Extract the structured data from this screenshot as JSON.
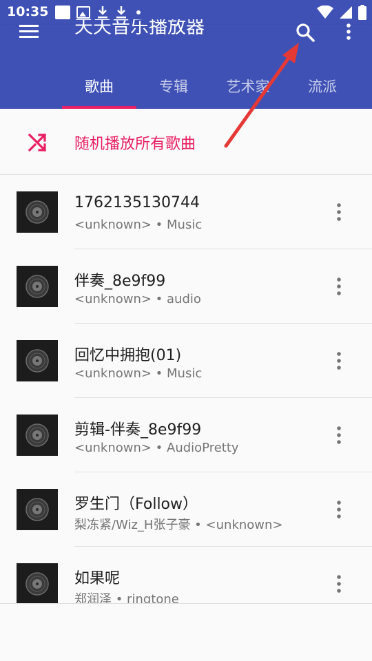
{
  "status_bar": {
    "time": "10:35",
    "icons": [
      "notification-square-icon",
      "image-icon",
      "download-icon",
      "download-icon",
      "dot-icon",
      "wifi-icon",
      "signal-icon",
      "battery-icon"
    ]
  },
  "app_bar": {
    "title": "天天音乐播放器",
    "background": "#3f51b5",
    "accent": "#e91e63",
    "tabs": [
      {
        "label": "歌曲",
        "selected": true
      },
      {
        "label": "专辑",
        "selected": false
      },
      {
        "label": "艺术家",
        "selected": false
      },
      {
        "label": "流派",
        "selected": false
      }
    ]
  },
  "shuffle": {
    "label": "随机播放所有歌曲"
  },
  "songs": [
    {
      "title": "1762135130744",
      "subtitle": "<unknown> • Music"
    },
    {
      "title": "伴奏_8e9f99",
      "subtitle": "<unknown> • audio"
    },
    {
      "title": "回忆中拥抱(01)",
      "subtitle": "<unknown> • Music"
    },
    {
      "title": "剪辑-伴奏_8e9f99",
      "subtitle": "<unknown> • AudioPretty"
    },
    {
      "title": "罗生门（Follow）",
      "subtitle": "梨冻紧/Wiz_H张子豪 • <unknown>"
    },
    {
      "title": "如果呢",
      "subtitle": "郑润泽 • ringtone"
    }
  ]
}
